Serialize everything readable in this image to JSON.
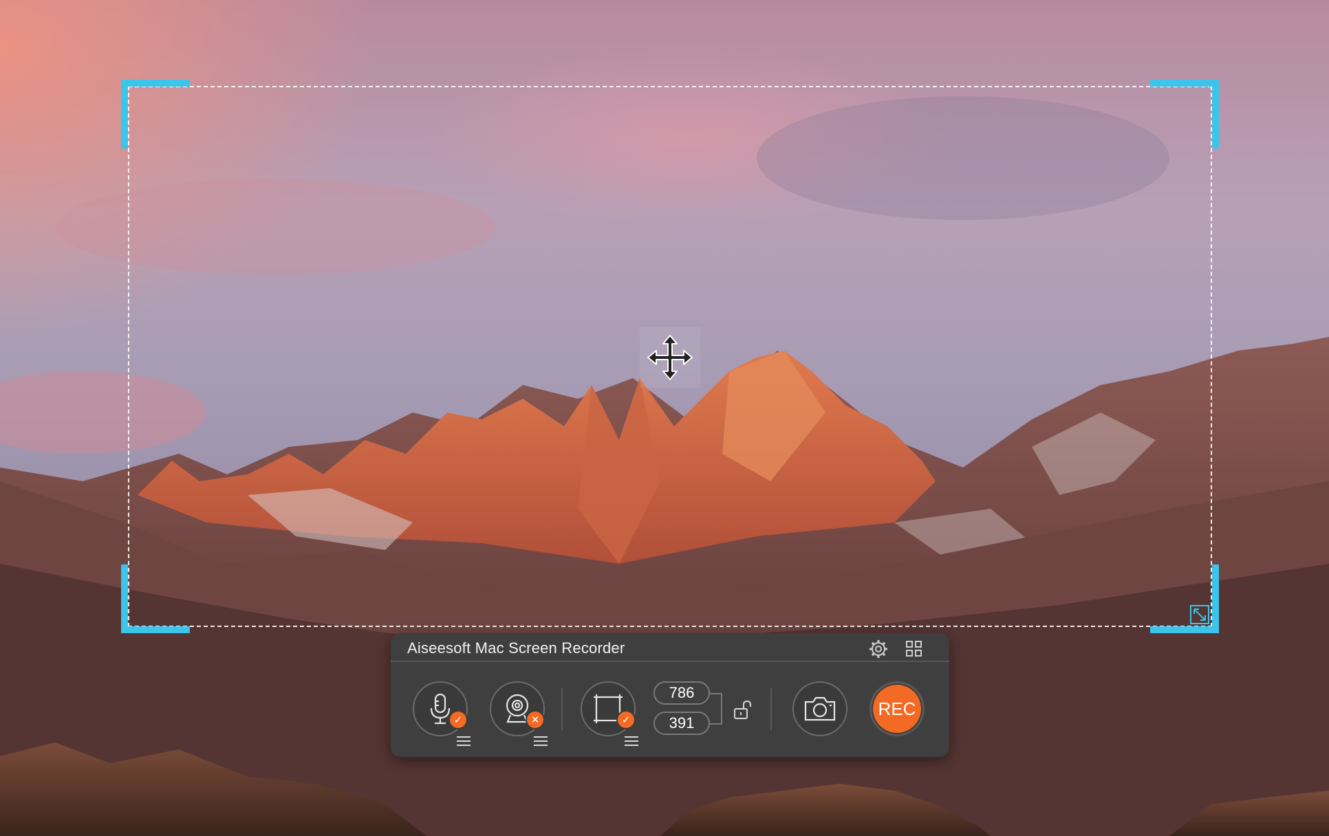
{
  "window": {
    "app_title": "Aiseesoft Mac Screen Recorder"
  },
  "selection": {
    "accent_color": "#3cc4ea",
    "border_style": "dashed-white"
  },
  "toolbar": {
    "icons": {
      "settings": "gear-icon",
      "layout": "grid-icon",
      "audio": "microphone-icon",
      "webcam": "webcam-icon",
      "region": "region-select-icon",
      "lock": "unlock-icon",
      "screenshot": "camera-icon"
    },
    "audio_status": "enabled",
    "webcam_status": "disabled",
    "region_status": "enabled",
    "width_value": "786",
    "height_value": "391",
    "rec_label": "REC",
    "accent_color": "#f26a23"
  },
  "desktop": {
    "wallpaper": "mountain-sunset-wallpaper"
  }
}
